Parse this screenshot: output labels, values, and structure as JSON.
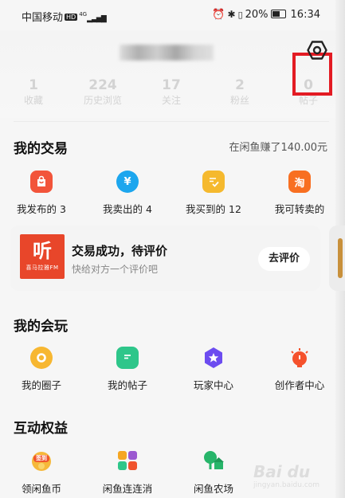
{
  "status_bar": {
    "carrier": "中国移动",
    "carrier_badge": "HD",
    "network": "4G",
    "battery_percent": "20%",
    "time": "16:34"
  },
  "profile": {
    "stats": [
      {
        "value": "1",
        "label": "收藏"
      },
      {
        "value": "224",
        "label": "历史浏览"
      },
      {
        "value": "17",
        "label": "关注"
      },
      {
        "value": "2",
        "label": "粉丝"
      },
      {
        "value": "0",
        "label": "帖子"
      }
    ]
  },
  "transactions": {
    "title": "我的交易",
    "earned_text": "在闲鱼赚了140.00元",
    "items": [
      {
        "label": "我发布的 3",
        "icon": "bag-icon",
        "color": "#f2543a"
      },
      {
        "label": "我卖出的 4",
        "icon": "yuan-icon",
        "color": "#1ca6ee"
      },
      {
        "label": "我买到的 12",
        "icon": "checklist-icon",
        "color": "#f5b92e"
      },
      {
        "label": "我可转卖的",
        "icon": "tao-icon",
        "color": "#f86f21"
      }
    ],
    "card": {
      "logo_main": "听",
      "logo_sub": "喜马拉雅FM",
      "title": "交易成功，待评价",
      "subtitle": "快给对方一个评价吧",
      "button_label": "去评价"
    }
  },
  "play": {
    "title": "我的会玩",
    "items": [
      {
        "label": "我的圈子",
        "icon": "circle-icon",
        "color": "#f7b731"
      },
      {
        "label": "我的帖子",
        "icon": "post-icon",
        "color": "#2ec68a"
      },
      {
        "label": "玩家中心",
        "icon": "star-badge-icon",
        "color": "#6c4cf0"
      },
      {
        "label": "创作者中心",
        "icon": "bulb-icon",
        "color": "#f5512c"
      }
    ]
  },
  "benefits": {
    "title": "互动权益",
    "items": [
      {
        "label": "领闲鱼币",
        "icon": "signin-coin-icon",
        "badge": "签到"
      },
      {
        "label": "闲鱼连连消",
        "icon": "match-game-icon"
      },
      {
        "label": "闲鱼农场",
        "icon": "farm-tree-icon"
      }
    ]
  },
  "watermark": {
    "text": "Bai du",
    "sub": "jingyan.baidu.com"
  }
}
